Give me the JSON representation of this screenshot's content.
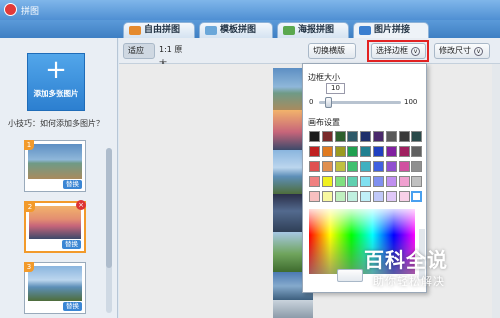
{
  "window": {
    "title": "拼图"
  },
  "tabs": [
    {
      "label": "自由拼图",
      "icon": "free-collage-icon",
      "color": "#e58a2d"
    },
    {
      "label": "模板拼图",
      "icon": "template-collage-icon",
      "color": "#6aa7d9"
    },
    {
      "label": "海报拼图",
      "icon": "poster-collage-icon",
      "color": "#5aa84f"
    },
    {
      "label": "图片拼接",
      "icon": "image-splice-icon",
      "color": "#3b7fd0",
      "active": true
    }
  ],
  "sidebar": {
    "add_button": {
      "icon": "+",
      "label": "添加多张图片"
    },
    "tip": "小技巧：如何添加多图片？",
    "thumbnails": [
      {
        "index": "1",
        "replace_label": "替换",
        "colors": [
          "#5d8fc3",
          "#6f9a86",
          "#a98b5e"
        ]
      },
      {
        "index": "2",
        "replace_label": "替换",
        "colors": [
          "#f2b36b",
          "#c7657a",
          "#3c4a6a"
        ],
        "selected": true,
        "close": "×"
      },
      {
        "index": "3",
        "replace_label": "替换",
        "colors": [
          "#8ab5de",
          "#5d8fb8",
          "#4f6d3b"
        ]
      }
    ]
  },
  "toolbar": {
    "fit_label": "适应",
    "original_label": "1:1 原大",
    "switch_layout_label": "切换横版",
    "select_border_label": "选择边框",
    "change_size_label": "修改尺寸",
    "dropdown_icon": "chevron-down-icon"
  },
  "border_popup": {
    "size_title": "边框大小",
    "size_value": "10",
    "slider_min": "0",
    "slider_max": "100",
    "slider_value": 10,
    "color_title": "画布设置",
    "swatch_rows": [
      [
        "#1a1a1a",
        "#7a2a2a",
        "#2d5f2d",
        "#2f5a6a",
        "#1e2f6b",
        "#4a2a6b",
        "#5a5a5a",
        "#3a3a3a",
        "#2a4a4a"
      ],
      [
        "#c02020",
        "#e07a20",
        "#9a9a20",
        "#20a050",
        "#208090",
        "#2040c0",
        "#8020a0",
        "#a02060",
        "#606060"
      ],
      [
        "#e05050",
        "#e09050",
        "#c0c040",
        "#40c070",
        "#40b0c0",
        "#4060e0",
        "#9050d0",
        "#d050a0",
        "#909090"
      ],
      [
        "#f08080",
        "#f0f020",
        "#80e080",
        "#60d0b0",
        "#80e0f0",
        "#8090f0",
        "#c090f0",
        "#f0a0d0",
        "#c0c0c0"
      ],
      [
        "#f8c0c0",
        "#f8f8a0",
        "#c0f0c0",
        "#c0f0e0",
        "#c0f0f8",
        "#c0c8f8",
        "#e0c8f8",
        "#f8d0e8",
        "#ffffff"
      ]
    ]
  },
  "watermark": {
    "title": "百科全说",
    "subtitle": "助你轻松解决"
  }
}
